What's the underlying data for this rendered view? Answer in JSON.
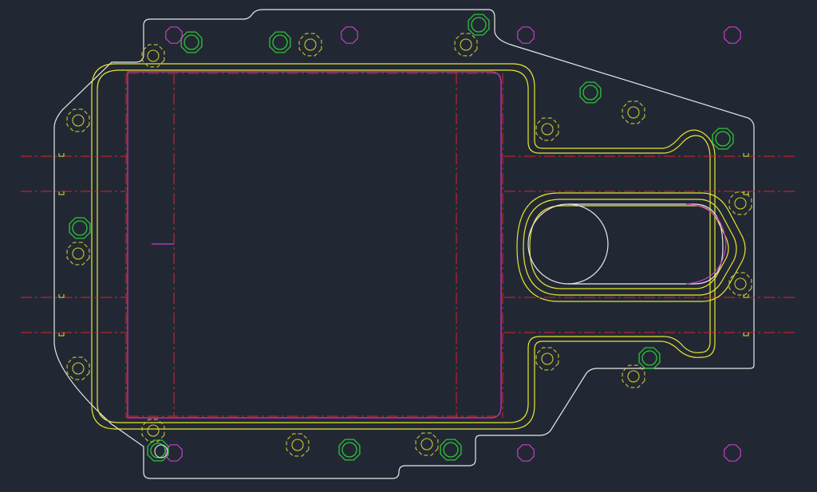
{
  "drawing": {
    "colors": {
      "background": "#222833",
      "outline": "#e8e8e8",
      "gasket": "#e6e633",
      "centerline": "#e0202a",
      "bolt_green": "#2fc43a",
      "bolt_yellow": "#c8c832",
      "marker_magenta": "#c83cc8"
    },
    "layers": [
      "outline",
      "gasket",
      "centerline",
      "bolt_green",
      "bolt_yellow",
      "marker_magenta"
    ]
  }
}
